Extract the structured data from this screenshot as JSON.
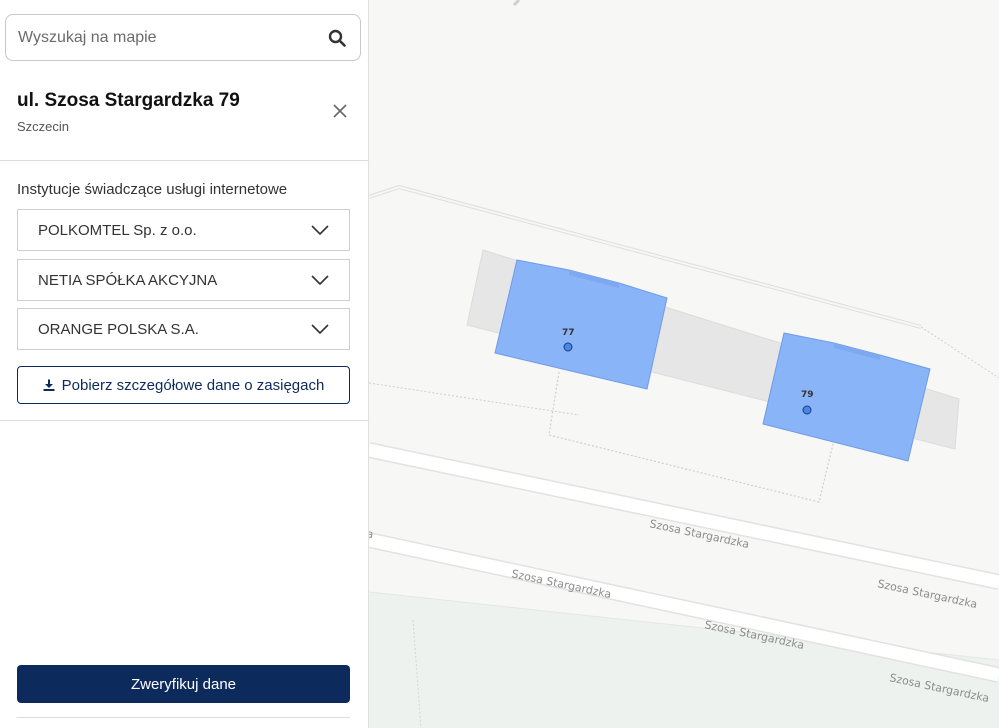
{
  "search": {
    "placeholder": "Wyszukaj na mapie",
    "value": ""
  },
  "address": {
    "title": "ul. Szosa Stargardzka 79",
    "city": "Szczecin"
  },
  "providers_section": {
    "heading": "Instytucje świadczące usługi internetowe",
    "providers": [
      {
        "name": "POLKOMTEL Sp. z o.o."
      },
      {
        "name": "NETIA SPÓŁKA AKCYJNA"
      },
      {
        "name": "ORANGE POLSKA S.A."
      }
    ]
  },
  "actions": {
    "download_label": "Pobierz szczegółowe dane o zasięgach",
    "verify_label": "Zweryfikuj dane"
  },
  "map": {
    "buildings": [
      {
        "number": "77"
      },
      {
        "number": "79"
      }
    ],
    "street_labels": [
      {
        "text": "Szosa Stargardzka"
      },
      {
        "text": "Szosa Stargardzka"
      },
      {
        "text": "Szosa Stargardzka"
      },
      {
        "text": "Szosa Stargardzka"
      },
      {
        "text": "Szosa Stargardzka"
      },
      {
        "text": "a"
      }
    ]
  },
  "colors": {
    "primary": "#0d2a5c",
    "building": "#8ab4f8",
    "building_stroke": "#6f9be6",
    "marker": "#4a86e8"
  },
  "icons": {
    "search": "search-icon",
    "close": "close-icon",
    "chevron": "chevron-down-icon",
    "download": "download-icon",
    "marker": "address-point-icon"
  }
}
